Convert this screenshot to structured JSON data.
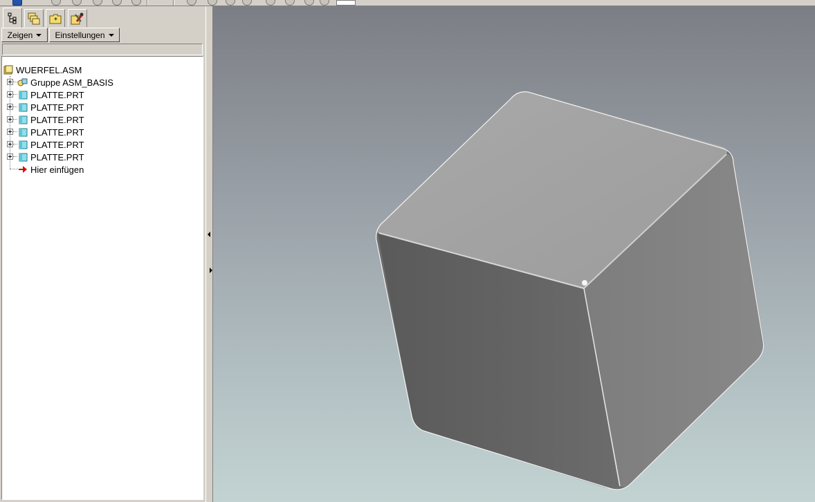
{
  "toolbar": {
    "visible": "partially cut off at top edge"
  },
  "nav_tabs": [
    {
      "name": "model-tree",
      "icon": "model-tree-icon",
      "active": true
    },
    {
      "name": "layers",
      "icon": "layers-icon",
      "active": false
    },
    {
      "name": "folder-browser",
      "icon": "folder-icon",
      "active": false
    },
    {
      "name": "favorites-tools",
      "icon": "tools-icon",
      "active": false
    }
  ],
  "menus": {
    "show_label": "Zeigen",
    "settings_label": "Einstellungen"
  },
  "tree": {
    "root": {
      "label": "WUERFEL.ASM",
      "icon": "assembly-icon"
    },
    "items": [
      {
        "label": "Gruppe ASM_BASIS",
        "icon": "group-icon"
      },
      {
        "label": "PLATTE.PRT",
        "icon": "part-icon"
      },
      {
        "label": "PLATTE.PRT",
        "icon": "part-icon"
      },
      {
        "label": "PLATTE.PRT",
        "icon": "part-icon"
      },
      {
        "label": "PLATTE.PRT",
        "icon": "part-icon"
      },
      {
        "label": "PLATTE.PRT",
        "icon": "part-icon"
      },
      {
        "label": "PLATTE.PRT",
        "icon": "part-icon"
      }
    ],
    "insert_here": {
      "label": "Hier einfügen",
      "icon": "insert-arrow-icon"
    }
  },
  "viewport": {
    "model": "rounded cube assembly",
    "background_top": "#7c7e85",
    "background_bottom": "#c3d3d2"
  },
  "colors": {
    "panel": "#d4d0c8",
    "cube_top": "#a3a3a3",
    "cube_left": "#626262",
    "cube_right": "#858585",
    "edge_highlight": "#ffffff"
  }
}
